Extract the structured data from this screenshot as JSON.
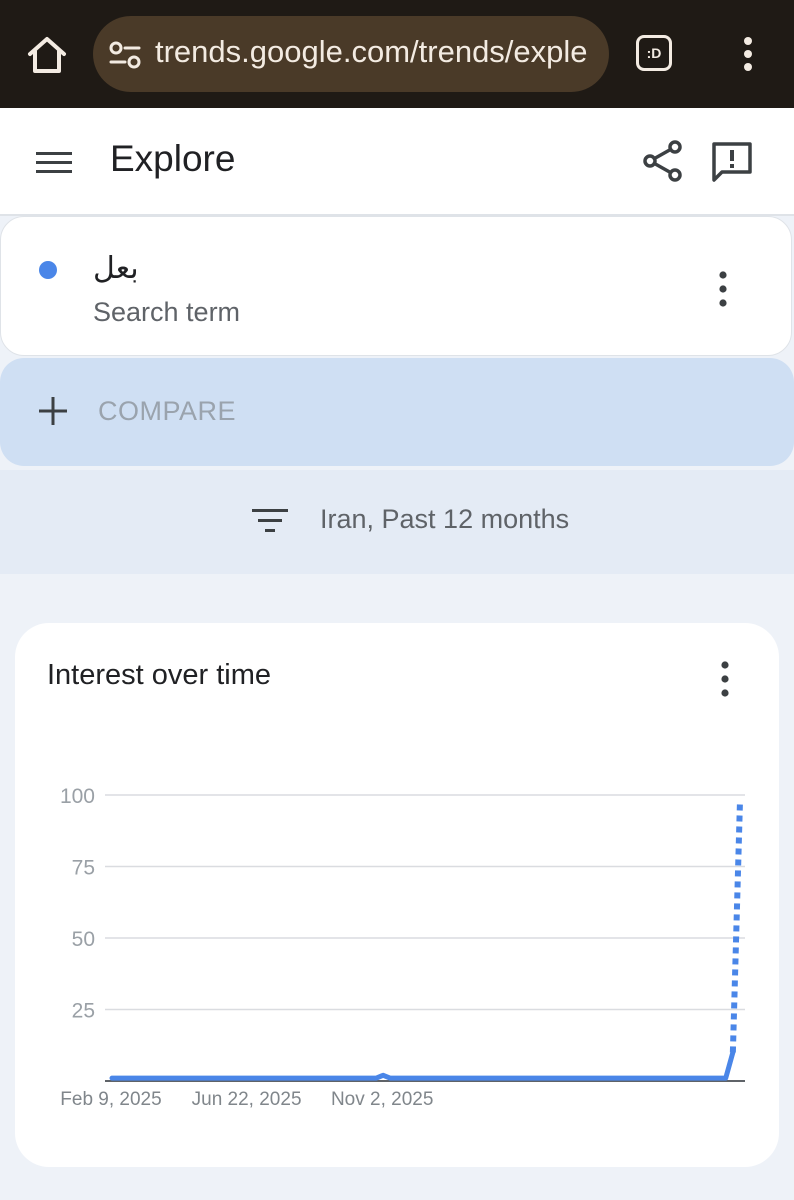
{
  "browser": {
    "url": "trends.google.com/trends/exple",
    "tab_label": ":D"
  },
  "header": {
    "title": "Explore"
  },
  "term": {
    "name": "بعل",
    "type": "Search term",
    "color": "#4a86e8"
  },
  "compare": {
    "label": "COMPARE"
  },
  "filter": {
    "label": "Iran, Past 12 months"
  },
  "chart": {
    "title": "Interest over time"
  },
  "icons": [
    "home-icon",
    "site-settings-icon",
    "tab-switcher-icon",
    "more-vert-icon",
    "hamburger-icon",
    "share-icon",
    "feedback-icon",
    "plus-icon",
    "filter-icon"
  ],
  "chart_data": {
    "type": "line",
    "title": "Interest over time",
    "xlabel": "",
    "ylabel": "",
    "ylim": [
      0,
      100
    ],
    "yticks": [
      100,
      75,
      50,
      25
    ],
    "xtick_labels": [
      "Feb 9, 2025",
      "Jun 22, 2025",
      "Nov 2, 2025"
    ],
    "xtick_index": [
      0,
      19,
      38
    ],
    "grid": true,
    "legend": "none",
    "series": [
      {
        "color": "#4a86e8",
        "values": [
          1,
          1,
          1,
          1,
          1,
          1,
          1,
          1,
          1,
          1,
          1,
          1,
          1,
          1,
          1,
          1,
          1,
          1,
          1,
          1,
          1,
          1,
          1,
          1,
          1,
          1,
          1,
          1,
          1,
          1,
          1,
          1,
          1,
          1,
          1,
          1,
          1,
          1,
          2,
          1,
          1,
          1,
          1,
          1,
          1,
          1,
          1,
          1,
          1,
          1,
          1,
          1,
          1,
          1,
          1,
          1,
          1,
          1,
          1,
          1,
          1,
          1,
          1,
          1,
          1,
          1,
          1,
          1,
          1,
          1,
          1,
          1,
          1,
          1,
          1,
          1,
          1,
          1,
          1,
          1,
          1,
          1,
          1,
          1,
          1,
          1,
          1,
          10,
          98
        ],
        "solid_until_index": 87
      }
    ]
  }
}
